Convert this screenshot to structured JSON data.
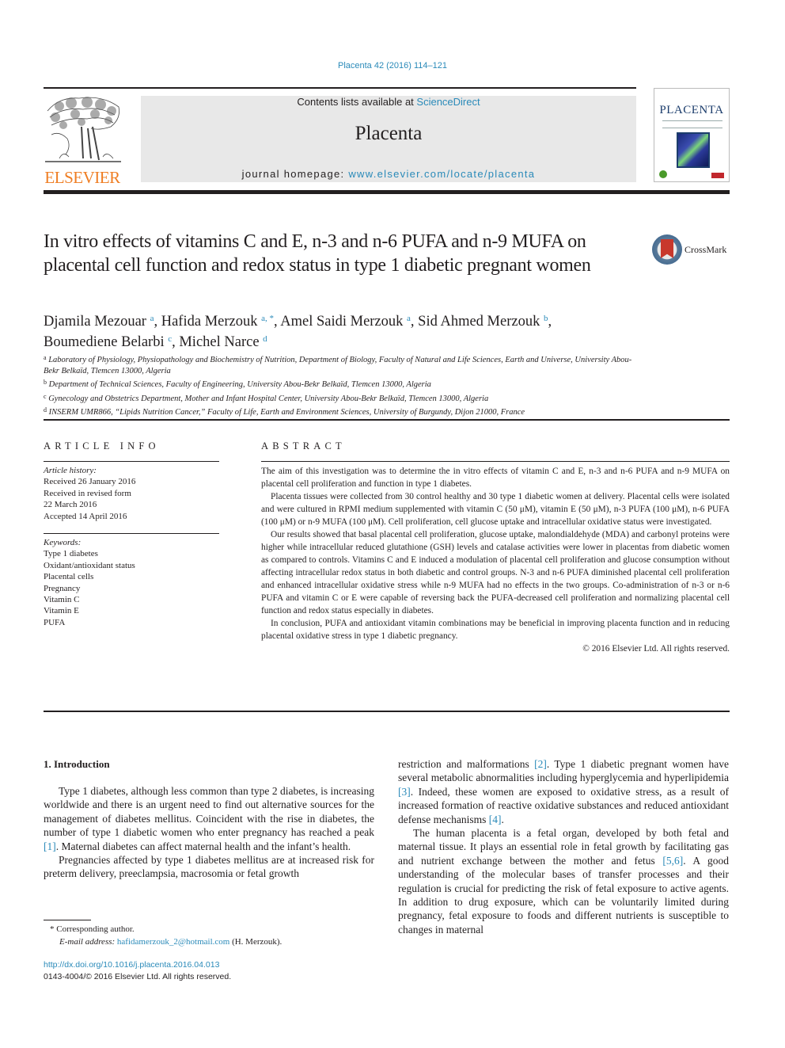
{
  "header": {
    "journal_ref": "Placenta 42 (2016) 114–121",
    "contents_prefix": "Contents lists available at ",
    "contents_link": "ScienceDirect",
    "journal_name": "Placenta",
    "homepage_prefix": "journal homepage: ",
    "homepage_link": "www.elsevier.com/locate/placenta",
    "publisher_logo_text": "ELSEVIER",
    "cover_title": "PLACENTA",
    "colors": {
      "link": "#2a8ab9",
      "elsevier_orange": "#ef7d22",
      "masthead_gray": "#e8e8e8"
    }
  },
  "article": {
    "title": "In vitro effects of vitamins C and E, n-3 and n-6 PUFA and n-9 MUFA on placental cell function and redox status in type 1 diabetic pregnant women",
    "crossmark_label": "CrossMark",
    "authors": [
      {
        "name": "Djamila Mezouar",
        "sup": "a",
        "sep": ", "
      },
      {
        "name": "Hafida Merzouk",
        "sup": "a, *",
        "sep": ", "
      },
      {
        "name": "Amel Saidi Merzouk",
        "sup": "a",
        "sep": ", "
      },
      {
        "name": "Sid Ahmed Merzouk",
        "sup": "b",
        "sep": ","
      },
      {
        "name": "Boumediene Belarbi",
        "sup": "c",
        "sep": ", "
      },
      {
        "name": "Michel Narce",
        "sup": "d",
        "sep": ""
      }
    ],
    "affiliations": [
      {
        "key": "a",
        "text": "Laboratory of Physiology, Physiopathology and Biochemistry of Nutrition, Department of Biology, Faculty of Natural and Life Sciences, Earth and Universe, University Abou-Bekr Belkaïd, Tlemcen 13000, Algeria"
      },
      {
        "key": "b",
        "text": "Department of Technical Sciences, Faculty of Engineering, University Abou-Bekr Belkaïd, Tlemcen 13000, Algeria"
      },
      {
        "key": "c",
        "text": "Gynecology and Obstetrics Department, Mother and Infant Hospital Center, University Abou-Bekr Belkaïd, Tlemcen 13000, Algeria"
      },
      {
        "key": "d",
        "text": "INSERM UMR866, “Lipids Nutrition Cancer,” Faculty of Life, Earth and Environment Sciences, University of Burgundy, Dijon 21000, France"
      }
    ]
  },
  "article_info": {
    "heading": "ARTICLE INFO",
    "history_label": "Article history:",
    "history": [
      "Received 26 January 2016",
      "Received in revised form",
      "22 March 2016",
      "Accepted 14 April 2016"
    ],
    "keywords_label": "Keywords:",
    "keywords": [
      "Type 1 diabetes",
      "Oxidant/antioxidant status",
      "Placental cells",
      "Pregnancy",
      "Vitamin C",
      "Vitamin E",
      "PUFA"
    ]
  },
  "abstract": {
    "heading": "ABSTRACT",
    "paragraphs": [
      "The aim of this investigation was to determine the in vitro effects of vitamin C and E, n-3 and n-6 PUFA and n-9 MUFA on placental cell proliferation and function in type 1 diabetes.",
      "Placenta tissues were collected from 30 control healthy and 30 type 1 diabetic women at delivery. Placental cells were isolated and were cultured in RPMI medium supplemented with vitamin C (50 μM), vitamin E (50 μM), n-3 PUFA (100 μM), n-6 PUFA (100 μM) or n-9 MUFA (100 μM). Cell proliferation, cell glucose uptake and intracellular oxidative status were investigated.",
      "Our results showed that basal placental cell proliferation, glucose uptake, malondialdehyde (MDA) and carbonyl proteins were higher while intracellular reduced glutathione (GSH) levels and catalase activities were lower in placentas from diabetic women as compared to controls. Vitamins C and E induced a modulation of placental cell proliferation and glucose consumption without affecting intracellular redox status in both diabetic and control groups. N-3 and n-6 PUFA diminished placental cell proliferation and enhanced intracellular oxidative stress while n-9 MUFA had no effects in the two groups. Co-administration of n-3 or n-6 PUFA and vitamin C or E were capable of reversing back the PUFA-decreased cell proliferation and normalizing placental cell function and redox status especially in diabetes.",
      "In conclusion, PUFA and antioxidant vitamin combinations may be beneficial in improving placenta function and in reducing placental oxidative stress in type 1 diabetic pregnancy."
    ],
    "copyright": "© 2016 Elsevier Ltd. All rights reserved."
  },
  "introduction": {
    "heading": "1.  Introduction",
    "left_p1_before": "Type 1 diabetes, although less common than type 2 diabetes, is increasing worldwide and there is an urgent need to find out alternative sources for the management of diabetes mellitus. Coincident with the rise in diabetes, the number of type 1 diabetic women who enter pregnancy has reached a peak ",
    "left_p1_ref": "[1]",
    "left_p1_after": ". Maternal diabetes can affect maternal health and the infant’s health.",
    "left_p2": "Pregnancies affected by type 1 diabetes mellitus are at increased risk for preterm delivery, preeclampsia, macrosomia or fetal growth",
    "right_p1": [
      {
        "text": "restriction and malformations "
      },
      {
        "ref": "[2]"
      },
      {
        "text": ". Type 1 diabetic pregnant women have several metabolic abnormalities including hyperglycemia and hyperlipidemia "
      },
      {
        "ref": "[3]"
      },
      {
        "text": ". Indeed, these women are exposed to oxidative stress, as a result of increased formation of reactive oxidative substances and reduced antioxidant defense mechanisms "
      },
      {
        "ref": "[4]"
      },
      {
        "text": "."
      }
    ],
    "right_p2": [
      {
        "text": "The human placenta is a fetal organ, developed by both fetal and maternal tissue. It plays an essential role in fetal growth by facilitating gas and nutrient exchange between the mother and fetus "
      },
      {
        "ref": "[5,6]"
      },
      {
        "text": ". A good understanding of the molecular bases of transfer processes and their regulation is crucial for predicting the risk of fetal exposure to active agents. In addition to drug exposure, which can be voluntarily limited during pregnancy, fetal exposure to foods and different nutrients is susceptible to changes in maternal"
      }
    ]
  },
  "footnotes": {
    "star": "* Corresponding author.",
    "email_label": "E-mail address:",
    "email": "hafidamerzouk_2@hotmail.com",
    "email_suffix": " (H. Merzouk).",
    "doi": "http://dx.doi.org/10.1016/j.placenta.2016.04.013",
    "issn_line": "0143-4004/© 2016 Elsevier Ltd. All rights reserved."
  }
}
